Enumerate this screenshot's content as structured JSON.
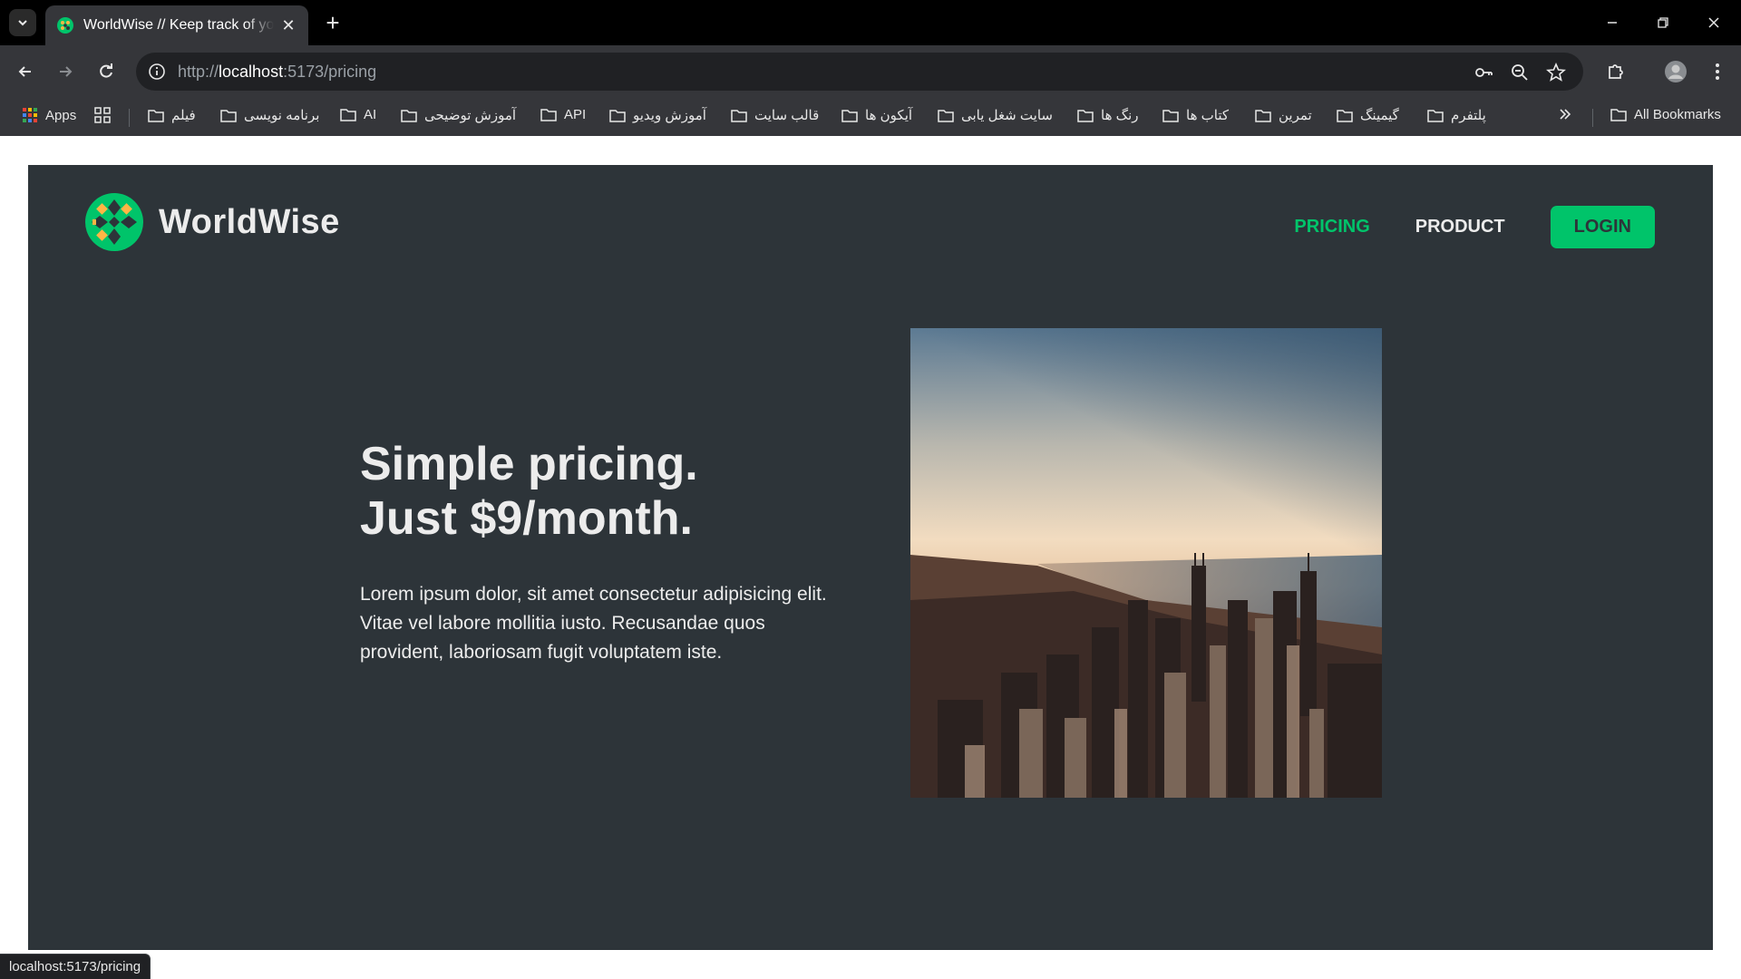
{
  "browser": {
    "tab_title": "WorldWise // Keep track of your adventures",
    "url_prefix": "http://",
    "url_host": "localhost",
    "url_path": ":5173/pricing",
    "status_url": "localhost:5173/pricing"
  },
  "bookmarks": {
    "apps_label": "Apps",
    "items": [
      {
        "label": "فیلم"
      },
      {
        "label": "برنامه نویسی"
      },
      {
        "label": "AI"
      },
      {
        "label": "آموزش توضیحی"
      },
      {
        "label": "API"
      },
      {
        "label": "آموزش ویدیو"
      },
      {
        "label": "قالب سایت"
      },
      {
        "label": "آیکون ها"
      },
      {
        "label": "سایت شغل یابی"
      },
      {
        "label": "رنگ ها"
      },
      {
        "label": "کتاب ها"
      },
      {
        "label": "تمرین"
      },
      {
        "label": "گیمینگ"
      },
      {
        "label": "پلتفرم"
      }
    ],
    "all_bookmarks_label": "All Bookmarks"
  },
  "site": {
    "brand": "WorldWise",
    "nav": {
      "pricing": "PRICING",
      "product": "PRODUCT",
      "login": "LOGIN"
    },
    "hero": {
      "title_line1": "Simple pricing.",
      "title_line2": "Just $9/month.",
      "text": "Lorem ipsum dolor, sit amet consectetur adipisicing elit. Vitae vel labore mollitia iusto. Recusandae quos provident, laboriosam fugit voluptatem iste."
    }
  },
  "colors": {
    "page_bg": "#2d3439",
    "accent": "#00c46a",
    "text_light": "#ececec",
    "logo_yellow": "#ffb545",
    "logo_green": "#00c46a"
  },
  "icons": {
    "tab_list": "chevron-down-icon",
    "close": "close-icon",
    "new_tab": "plus-icon",
    "back": "arrow-left-icon",
    "forward": "arrow-right-icon",
    "reload": "reload-icon",
    "site_info": "info-icon",
    "passwords": "key-icon",
    "zoom": "zoom-icon",
    "bookmark": "star-icon",
    "extensions": "puzzle-icon",
    "profile": "avatar",
    "menu": "kebab-menu-icon",
    "folder": "folder-icon",
    "overflow": "double-chevron-icon"
  }
}
